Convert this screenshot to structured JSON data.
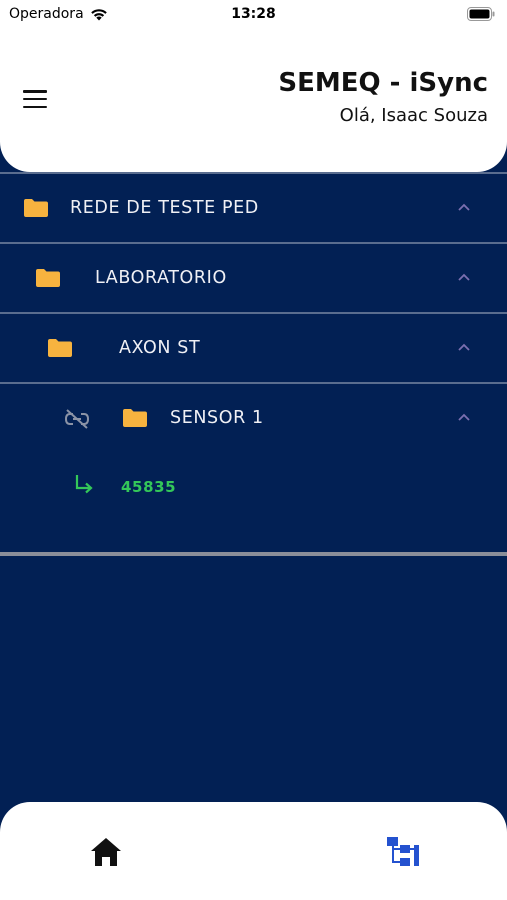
{
  "status_bar": {
    "carrier": "Operadora",
    "time": "13:28"
  },
  "header": {
    "title": "SEMEQ - iSync",
    "greeting": "Olá, Isaac Souza"
  },
  "tree": {
    "nodes": [
      {
        "label": "REDE DE TESTE PED"
      },
      {
        "label": "LABORATORIO"
      },
      {
        "label": "AXON ST"
      },
      {
        "label": "SENSOR 1"
      }
    ],
    "leaf": {
      "label": "45835"
    }
  },
  "colors": {
    "background": "#022054",
    "folder": "#f7b33f",
    "leaf": "#34c759",
    "chevron": "#7b6fb0",
    "tab_active": "#2452cf"
  },
  "icons": {
    "menu": "menu-icon",
    "wifi": "wifi-icon",
    "battery": "battery-icon",
    "folder": "folder-icon",
    "chevron": "chevron-up-icon",
    "unlink": "unlink-icon",
    "leaf_arrow": "subdirectory-arrow-icon",
    "home": "home-icon",
    "tree": "sitemap-icon"
  }
}
